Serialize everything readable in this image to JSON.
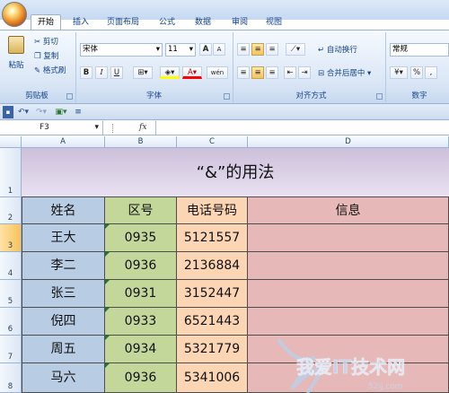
{
  "ribbon": {
    "tabs": [
      "开始",
      "插入",
      "页面布局",
      "公式",
      "数据",
      "审阅",
      "视图"
    ],
    "clipboard": {
      "paste": "粘贴",
      "cut": "剪切",
      "copy": "复制",
      "format_painter": "格式刷",
      "label": "剪贴板"
    },
    "font": {
      "name": "宋体",
      "size": "11",
      "bold": "B",
      "italic": "I",
      "underline": "U",
      "label": "字体",
      "grow": "A",
      "shrink": "A",
      "phonetic": "wén"
    },
    "alignment": {
      "wrap": "自动换行",
      "merge": "合并后居中",
      "label": "对齐方式"
    },
    "number": {
      "format": "常规",
      "percent": "%",
      "label": "数字"
    }
  },
  "formula_bar": {
    "name_box": "F3",
    "fx": "fx",
    "content": ""
  },
  "sheet": {
    "columns": [
      "A",
      "B",
      "C",
      "D"
    ],
    "row_numbers": [
      "1",
      "2",
      "3",
      "4",
      "5",
      "6",
      "7",
      "8"
    ],
    "title": "“&”的用法",
    "headers": [
      "姓名",
      "区号",
      "电话号码",
      "信息"
    ],
    "rows": [
      [
        "王大",
        "0935",
        "5121557",
        ""
      ],
      [
        "李二",
        "0936",
        "2136884",
        ""
      ],
      [
        "张三",
        "0931",
        "3152447",
        ""
      ],
      [
        "倪四",
        "0933",
        "6521443",
        ""
      ],
      [
        "周五",
        "0934",
        "5321779",
        ""
      ],
      [
        "马六",
        "0936",
        "5341006",
        ""
      ]
    ]
  },
  "watermark": {
    "text": "我爱IT技术网",
    "sub": "52ij.com"
  },
  "colors": {
    "col_a": "#b8cce4",
    "col_b": "#c4d79b",
    "col_c": "#fcd5b4",
    "col_d": "#e6b9b8",
    "title_bg": "#ccc0da"
  }
}
